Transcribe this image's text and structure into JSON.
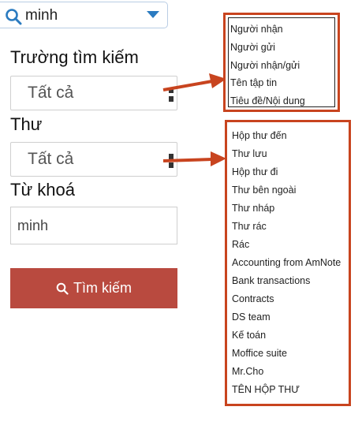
{
  "search": {
    "value": "minh",
    "icon": "search-icon"
  },
  "form": {
    "field_label": "Trường tìm kiếm",
    "field_value": "Tất cả",
    "mailbox_label": "Thư",
    "mailbox_value": "Tất cả",
    "keyword_label": "Từ khoá",
    "keyword_value": "minh",
    "search_button": "Tìm kiếm"
  },
  "field_options": [
    "Người nhận",
    "Người gửi",
    "Người nhận/gửi",
    "Tên tập tin",
    "Tiêu đề/Nội dung"
  ],
  "mailbox_options": [
    "Hộp thư đến",
    "Thư lưu",
    "Hộp thư đi",
    "Thư bên ngoài",
    "Thư nháp",
    "Thư rác",
    "Rác",
    "Accounting from AmNote",
    "Bank transactions",
    "Contracts",
    "DS team",
    "Kế toán",
    "Moffice suite",
    "Mr.Cho",
    "TÊN HỘP THƯ"
  ],
  "colors": {
    "accent_red": "#b94a3f",
    "annotation": "#c8441f",
    "link_blue": "#2b7bc0"
  }
}
